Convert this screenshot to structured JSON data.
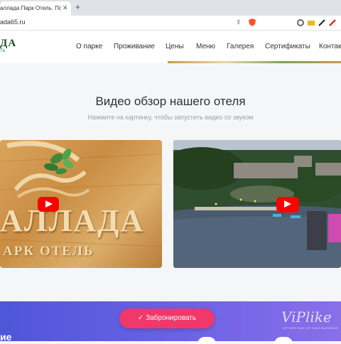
{
  "browser": {
    "tab_title": "аллада Парк Отель. Полно",
    "tab_close": "✕",
    "new_tab": "+",
    "url": "ada65.ru"
  },
  "site": {
    "logo_text": "ДА",
    "logo_sub": "ТЬ",
    "nav": [
      "О парке",
      "Проживание",
      "Цены",
      "Меню",
      "Галерея",
      "Сертификаты",
      "Контакт"
    ]
  },
  "section": {
    "title": "Видео обзор нашего отеля",
    "subtitle": "Нажмите на картинку, чтобы запустить видео со звуком"
  },
  "videos": [
    {
      "sign_line1": "АЛЛАДА",
      "sign_line2": "АРК ОТЕЛЬ"
    },
    {}
  ],
  "banner": {
    "book_label": "✓  Забронировать",
    "edge_text": "ие",
    "watermark": "ViPlike",
    "watermark_sub": "VIP WEB FACE OF YOUR BUSINESS"
  },
  "colors": {
    "accent_button": "#f0386b",
    "banner_start": "#4f56d8",
    "banner_end": "#8a6fe9",
    "youtube_red": "#ff0000"
  }
}
